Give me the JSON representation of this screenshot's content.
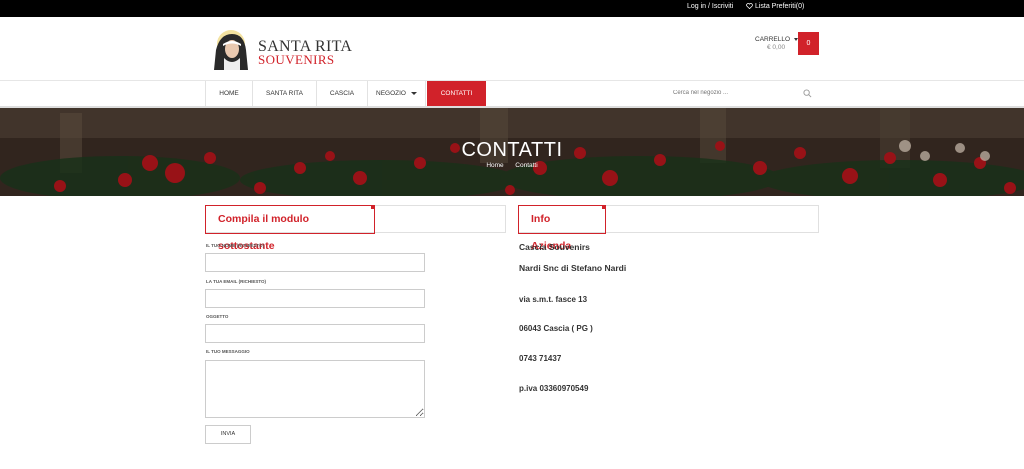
{
  "topbar": {
    "login_label": "Log in / Iscriviti",
    "wishlist_label": "Lista Preferiti(0)"
  },
  "brand": {
    "line1": "SANTA RITA",
    "line2": "SOUVENIRS",
    "accent_color": "#d1222a"
  },
  "cart": {
    "label": "CARRELLO",
    "amount": "€ 0,00",
    "count": "0"
  },
  "nav": {
    "items": [
      {
        "label": "HOME"
      },
      {
        "label": "SANTA RITA"
      },
      {
        "label": "CASCIA"
      },
      {
        "label": "NEGOZIO"
      },
      {
        "label": "CONTATTI"
      }
    ],
    "active_index": 4
  },
  "search": {
    "placeholder": "Cerca nel negozio ..."
  },
  "hero": {
    "title": "CONTATTI",
    "breadcrumb_home": "Home",
    "breadcrumb_current": "Contatti"
  },
  "form": {
    "heading": "Compila il modulo sottostante",
    "name_label": "IL TUO NOME (RICHIESTO)",
    "email_label": "LA TUA EMAIL (RICHIESTO)",
    "subject_label": "OGGETTO",
    "message_label": "IL TUO MESSAGGIO",
    "submit_label": "INVIA"
  },
  "info": {
    "heading": "Info Azienda",
    "company": "Cascia Souvenirs",
    "owner": "Nardi Snc di Stefano Nardi",
    "address": "via s.m.t. fasce 13",
    "city": "06043 Cascia ( PG )",
    "phone": "0743 71437",
    "vat": "p.iva 03360970549"
  }
}
